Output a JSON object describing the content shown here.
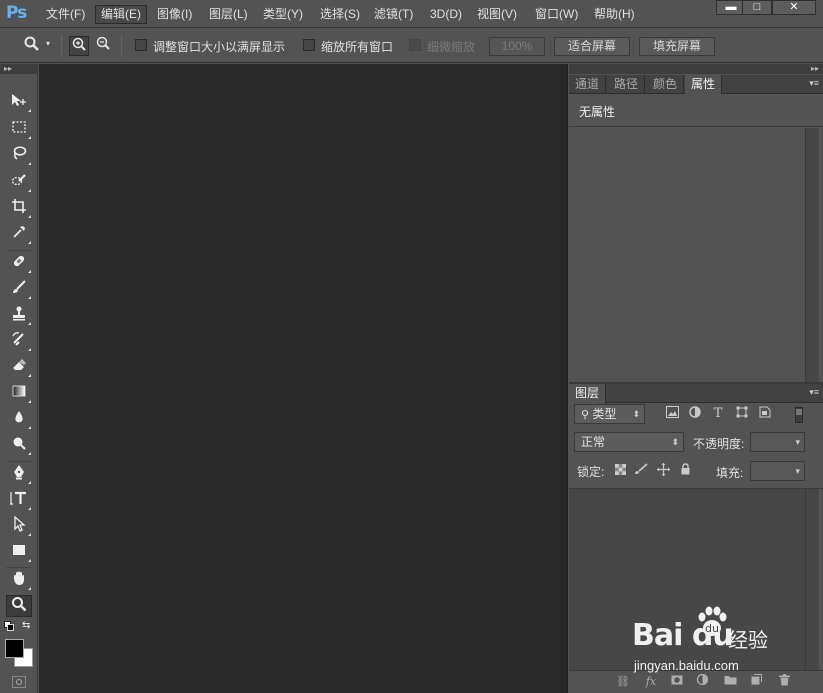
{
  "app": {
    "logo": "Ps"
  },
  "menu": {
    "items": [
      "文件(F)",
      "编辑(E)",
      "图像(I)",
      "图层(L)",
      "类型(Y)",
      "选择(S)",
      "滤镜(T)",
      "3D(D)",
      "视图(V)",
      "窗口(W)",
      "帮助(H)"
    ],
    "active_index": 1
  },
  "window_controls": {
    "minimize": "▬",
    "maximize": "□",
    "close": "✕"
  },
  "options": {
    "tool_icon": "zoom-icon",
    "resize_windows_label": "调整窗口大小以满屏显示",
    "zoom_all_windows_label": "缩放所有窗口",
    "scrubby_zoom_label": "细微缩放",
    "zoom_level": "100%",
    "fit_screen_label": "适合屏幕",
    "fill_screen_label": "填充屏幕"
  },
  "tools": [
    "move-tool-icon",
    "marquee-tool-icon",
    "lasso-tool-icon",
    "quick-selection-tool-icon",
    "crop-tool-icon",
    "eyedropper-tool-icon",
    "healing-brush-tool-icon",
    "brush-tool-icon",
    "clone-stamp-tool-icon",
    "history-brush-tool-icon",
    "eraser-tool-icon",
    "gradient-tool-icon",
    "blur-tool-icon",
    "dodge-tool-icon",
    "pen-tool-icon",
    "type-tool-icon",
    "path-selection-tool-icon",
    "rectangle-tool-icon",
    "hand-tool-icon",
    "zoom-tool-icon"
  ],
  "colors": {
    "foreground": "#000000",
    "background": "#ffffff",
    "canvas": "#282828",
    "ui": "#535353"
  },
  "properties_panel": {
    "tabs": [
      "通道",
      "路径",
      "颜色",
      "属性"
    ],
    "active_index": 3,
    "no_properties": "无属性"
  },
  "layers_panel": {
    "tab": "图层",
    "filter_kind": "类型",
    "blend_mode": "正常",
    "opacity_label": "不透明度:",
    "lock_label": "锁定:",
    "fill_label": "填充:"
  },
  "watermark": {
    "logo": "Bai du",
    "cn": "经验",
    "url": "jingyan.baidu.com"
  }
}
